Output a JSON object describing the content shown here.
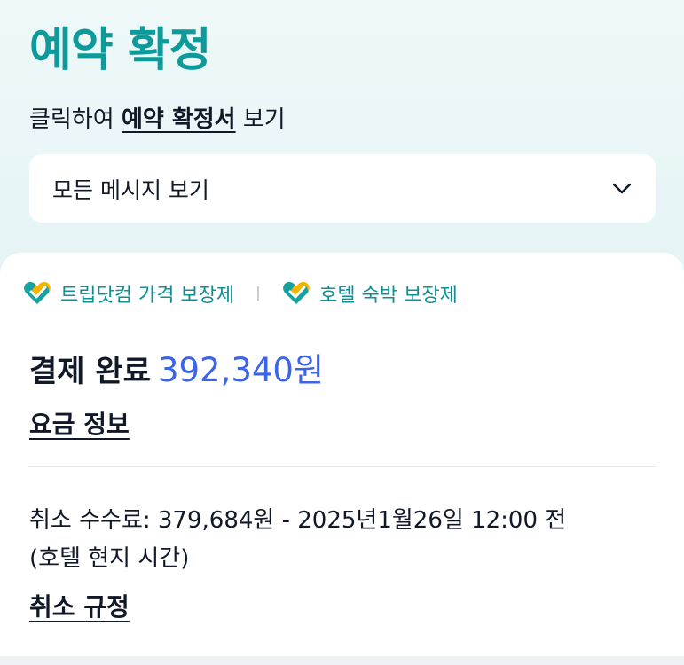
{
  "header": {
    "title": "예약 확정",
    "subline_prefix": "클릭하여 ",
    "subline_link": "예약 확정서",
    "subline_suffix": " 보기"
  },
  "messages_dropdown": {
    "label": "모든 메시지 보기",
    "icon": "chevron-down-icon"
  },
  "guarantees": [
    {
      "label": "트립닷컴 가격 보장제",
      "icon": "heart-check-icon"
    },
    {
      "label": "호텔 숙박 보장제",
      "icon": "heart-check-icon"
    }
  ],
  "payment": {
    "label": "결제 완료",
    "amount": "392,340원"
  },
  "fare_info_link": "요금 정보",
  "cancellation": {
    "fee_line": "취소 수수료: 379,684원 - 2025년1월26일 12:00 전",
    "timezone_note": "(호텔 현지 시간)",
    "policy_link": "취소 규정"
  },
  "colors": {
    "brand_teal": "#0e9a9a",
    "amount_blue": "#3b64e8",
    "heart_gold": "#f5b400",
    "heart_teal": "#14a3a3"
  }
}
